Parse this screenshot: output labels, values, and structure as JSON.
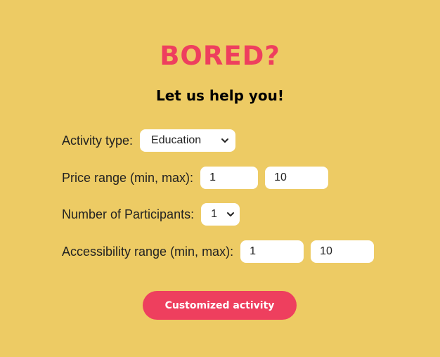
{
  "header": {
    "title": "BORED?",
    "subtitle": "Let us help you!"
  },
  "form": {
    "activity_type": {
      "label": "Activity type:",
      "selected": "Education",
      "icon": "chevron-down-icon"
    },
    "price_range": {
      "label": "Price range (min, max):",
      "min": "1",
      "max": "10"
    },
    "participants": {
      "label": "Number of Participants:",
      "selected": "1",
      "icon": "chevron-down-icon"
    },
    "accessibility_range": {
      "label": "Accessibility range (min, max):",
      "min": "1",
      "max": "10"
    }
  },
  "actions": {
    "submit_label": "Customized activity"
  },
  "colors": {
    "background": "#edcb64",
    "accent": "#ee3f5e",
    "field_background": "#ffffff"
  }
}
